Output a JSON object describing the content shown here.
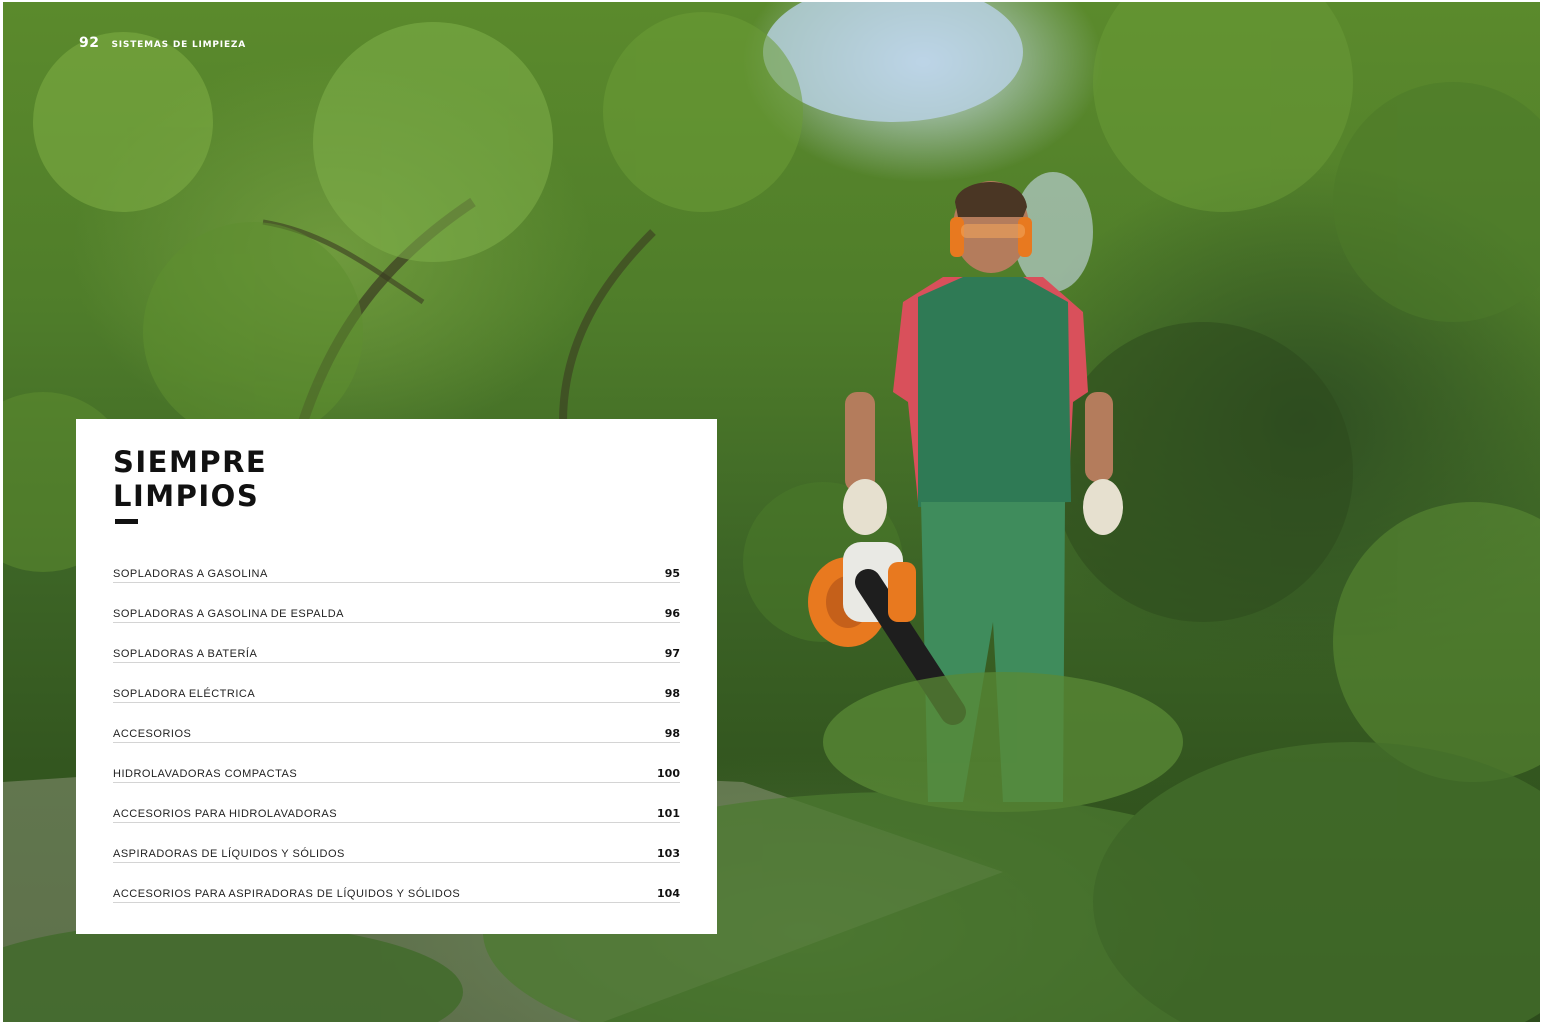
{
  "header": {
    "page_number": "92",
    "section_title": "SISTEMAS DE LIMPIEZA"
  },
  "toc": {
    "heading_line1": "SIEMPRE",
    "heading_line2": "LIMPIOS",
    "items": [
      {
        "label": "SOPLADORAS A GASOLINA",
        "page": "95"
      },
      {
        "label": "SOPLADORAS A GASOLINA DE ESPALDA",
        "page": "96"
      },
      {
        "label": "SOPLADORAS A BATERÍA",
        "page": "97"
      },
      {
        "label": "SOPLADORA ELÉCTRICA",
        "page": "98"
      },
      {
        "label": "ACCESORIOS",
        "page": "98"
      },
      {
        "label": "HIDROLAVADORAS COMPACTAS",
        "page": "100"
      },
      {
        "label": "ACCESORIOS PARA HIDROLAVADORAS",
        "page": "101"
      },
      {
        "label": "ASPIRADORAS DE LÍQUIDOS Y SÓLIDOS",
        "page": "103"
      },
      {
        "label": "ACCESORIOS PARA ASPIRADORAS DE LÍQUIDOS Y SÓLIDOS",
        "page": "104"
      }
    ]
  },
  "colors": {
    "foliage": "#4f7d2a",
    "panel": "#ffffff",
    "text": "#111111",
    "blower_orange": "#e8791f"
  }
}
